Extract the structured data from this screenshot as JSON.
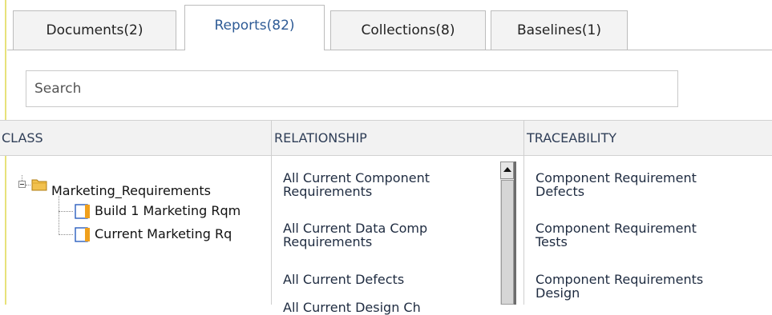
{
  "tabs": [
    {
      "label": "Documents(2)",
      "active": false
    },
    {
      "label": "Reports(82)",
      "active": true
    },
    {
      "label": "Collections(8)",
      "active": false
    },
    {
      "label": "Baselines(1)",
      "active": false
    }
  ],
  "search": {
    "placeholder": "Search",
    "value": ""
  },
  "columns": {
    "class": "CLASS",
    "relationship": "RELATIONSHIP",
    "traceability": "TRACEABILITY"
  },
  "tree": {
    "root": {
      "label": "Marketing_Requirements",
      "icon": "folder-icon",
      "expanded": true
    },
    "children": [
      {
        "label": "Build 1 Marketing Rqm",
        "icon": "report-icon"
      },
      {
        "label": "Current Marketing Rq",
        "icon": "report-icon"
      }
    ]
  },
  "relationship_items": [
    "All Current Component\nRequirements",
    "All Current Data Comp\nRequirements",
    "All Current Defects",
    "All Current Design Ch"
  ],
  "traceability_items": [
    "Component Requirement\nDefects",
    "Component Requirement\nTests",
    "Component Requirements\nDesign"
  ],
  "colors": {
    "active_tab_text": "#2e5b96",
    "header_bg": "#f2f2f2",
    "folder": "#f2c14e"
  }
}
